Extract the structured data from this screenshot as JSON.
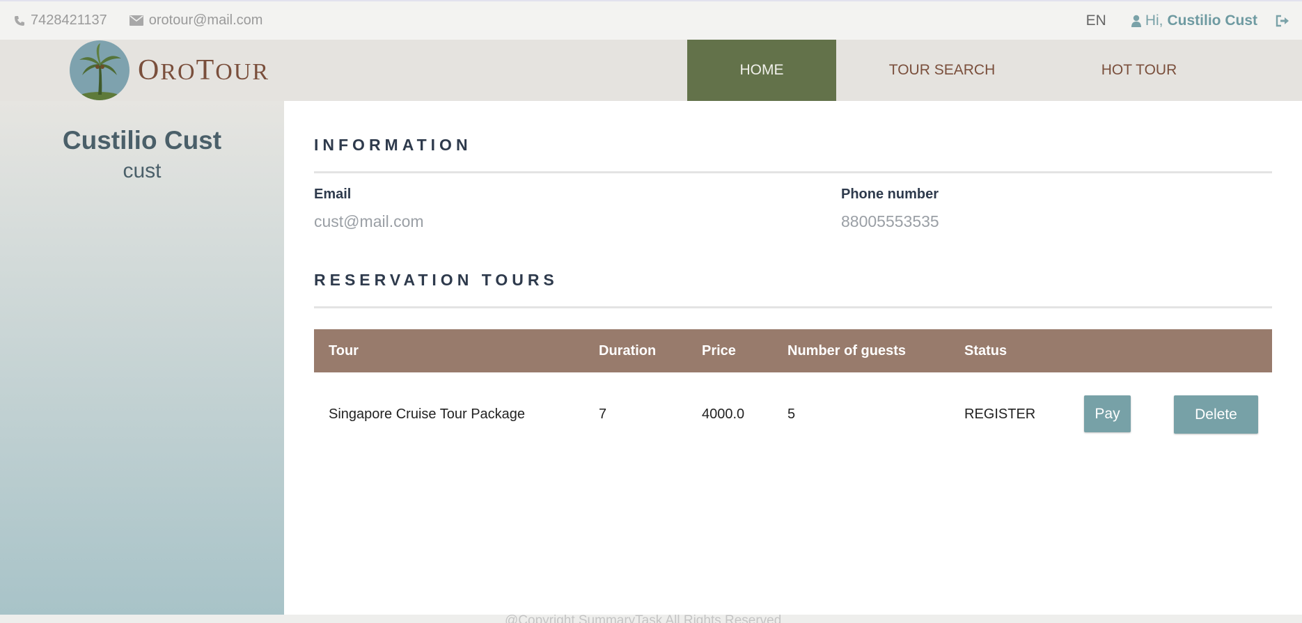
{
  "topbar": {
    "phone": "7428421137",
    "email": "orotour@mail.com",
    "language": "EN",
    "greeting_prefix": "Hi,",
    "user_name": "Custilio Cust"
  },
  "header": {
    "logo_text_first": "O",
    "logo_text_rest1": "RO",
    "logo_text_second": "T",
    "logo_text_rest2": "OUR",
    "nav": {
      "home": "HOME",
      "tour_search": "TOUR SEARCH",
      "hot_tour": "HOT TOUR"
    }
  },
  "sidebar": {
    "full_name": "Custilio Cust",
    "login": "cust"
  },
  "information": {
    "title": "INFORMATION",
    "email_label": "Email",
    "email_value": "cust@mail.com",
    "phone_label": "Phone number",
    "phone_value": "88005553535"
  },
  "reservations": {
    "title": "RESERVATION TOURS",
    "columns": {
      "tour": "Tour",
      "duration": "Duration",
      "price": "Price",
      "guests": "Number of guests",
      "status": "Status"
    },
    "rows": [
      {
        "tour": "Singapore Cruise Tour Package",
        "duration": "7",
        "price": "4000.0",
        "guests": "5",
        "status": "REGISTER",
        "pay_label": "Pay",
        "delete_label": "Delete"
      }
    ]
  },
  "footer": {
    "copyright": "@Copyright SummaryTask All Rights Reserved"
  },
  "icons": {
    "phone": "phone-icon",
    "email": "envelope-icon",
    "user": "user-icon",
    "logout": "sign-out-icon",
    "logo": "palm-tree-icon"
  },
  "colors": {
    "nav_active": "#63724a",
    "table_header": "#987b6c",
    "button": "#77a1a7",
    "brand_text": "#7a4f3c"
  }
}
